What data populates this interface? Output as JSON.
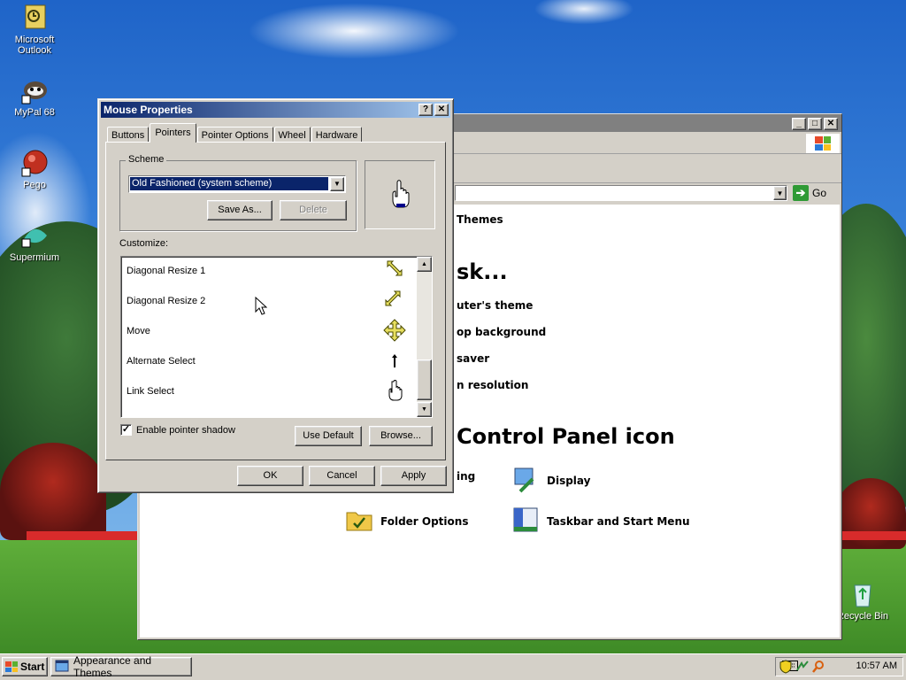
{
  "desktop": {
    "icons": [
      {
        "label_line1": "Microsoft",
        "label_line2": "Outlook",
        "icon": "outlook-icon"
      },
      {
        "label_line1": "MyPal 68",
        "label_line2": "",
        "icon": "mypal-icon"
      },
      {
        "label_line1": "Pego",
        "label_line2": "",
        "icon": "pego-icon"
      },
      {
        "label_line1": "Supermium",
        "label_line2": "",
        "icon": "supermium-icon"
      },
      {
        "label_line1": "Recycle Bin",
        "label_line2": "",
        "icon": "recycle-bin-icon"
      }
    ]
  },
  "control_panel": {
    "go_label": "Go",
    "themes_link": "Themes",
    "pick_task_fragment": "sk...",
    "tasks": [
      "uter's theme",
      "op background",
      "saver",
      "n resolution"
    ],
    "pick_icon_fragment": "Control Panel icon",
    "icons": [
      {
        "label": "ing",
        "icon": "accessibility-icon"
      },
      {
        "label": "Display",
        "icon": "display-icon"
      },
      {
        "label": "Folder Options",
        "icon": "folder-options-icon"
      },
      {
        "label": "Taskbar and Start Menu",
        "icon": "taskbar-start-menu-icon"
      }
    ]
  },
  "mouse_properties": {
    "title": "Mouse Properties",
    "help_btn": "?",
    "close_btn": "✕",
    "tabs": [
      "Buttons",
      "Pointers",
      "Pointer Options",
      "Wheel",
      "Hardware"
    ],
    "active_tab": "Pointers",
    "scheme_label": "Scheme",
    "scheme_value": "Old Fashioned (system scheme)",
    "save_as": "Save As...",
    "delete": "Delete",
    "customize_label": "Customize:",
    "pointer_rows": [
      {
        "label": "Diagonal Resize 1",
        "icon": "diagonal-resize-1-icon"
      },
      {
        "label": "Diagonal Resize 2",
        "icon": "diagonal-resize-2-icon"
      },
      {
        "label": "Move",
        "icon": "move-icon"
      },
      {
        "label": "Alternate Select",
        "icon": "alternate-select-icon"
      },
      {
        "label": "Link Select",
        "icon": "link-select-icon"
      }
    ],
    "enable_shadow_label": "Enable pointer shadow",
    "enable_shadow_checked": true,
    "use_default": "Use Default",
    "browse": "Browse...",
    "ok": "OK",
    "cancel": "Cancel",
    "apply": "Apply"
  },
  "taskbar": {
    "start": "Start",
    "task_item": "Appearance and Themes",
    "clock": "10:57 AM"
  },
  "colors": {
    "title_active": "#0a246a",
    "title_gradient_end": "#a6caf0",
    "face": "#d4d0c8",
    "selection": "#0a246a"
  }
}
